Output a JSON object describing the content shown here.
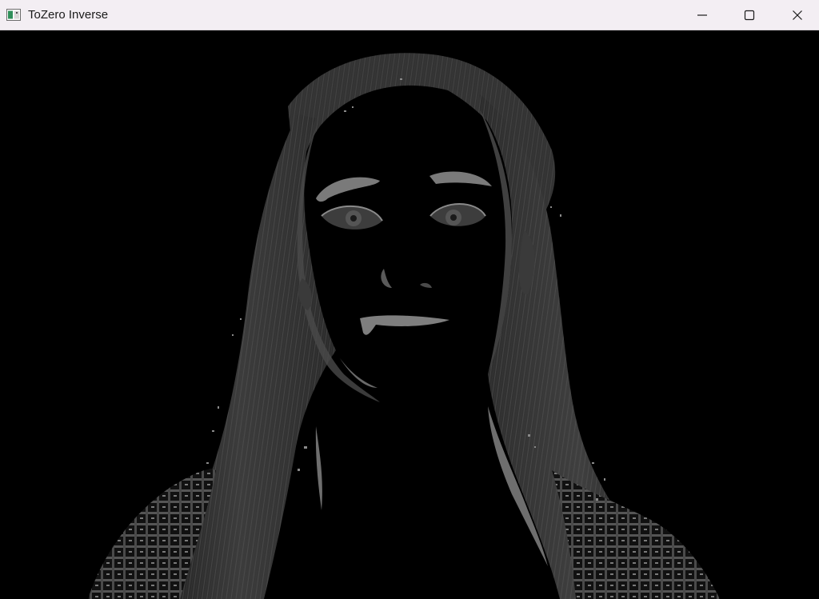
{
  "window": {
    "title": "ToZero Inverse",
    "app_icon": "opencv-window-icon",
    "controls": {
      "minimize_icon": "minimize-icon",
      "maximize_icon": "maximize-icon",
      "close_icon": "close-icon"
    }
  },
  "image": {
    "icon": "thresholded-portrait-image",
    "background_color": "#000000",
    "foreground_color": "#8a8a8a"
  }
}
